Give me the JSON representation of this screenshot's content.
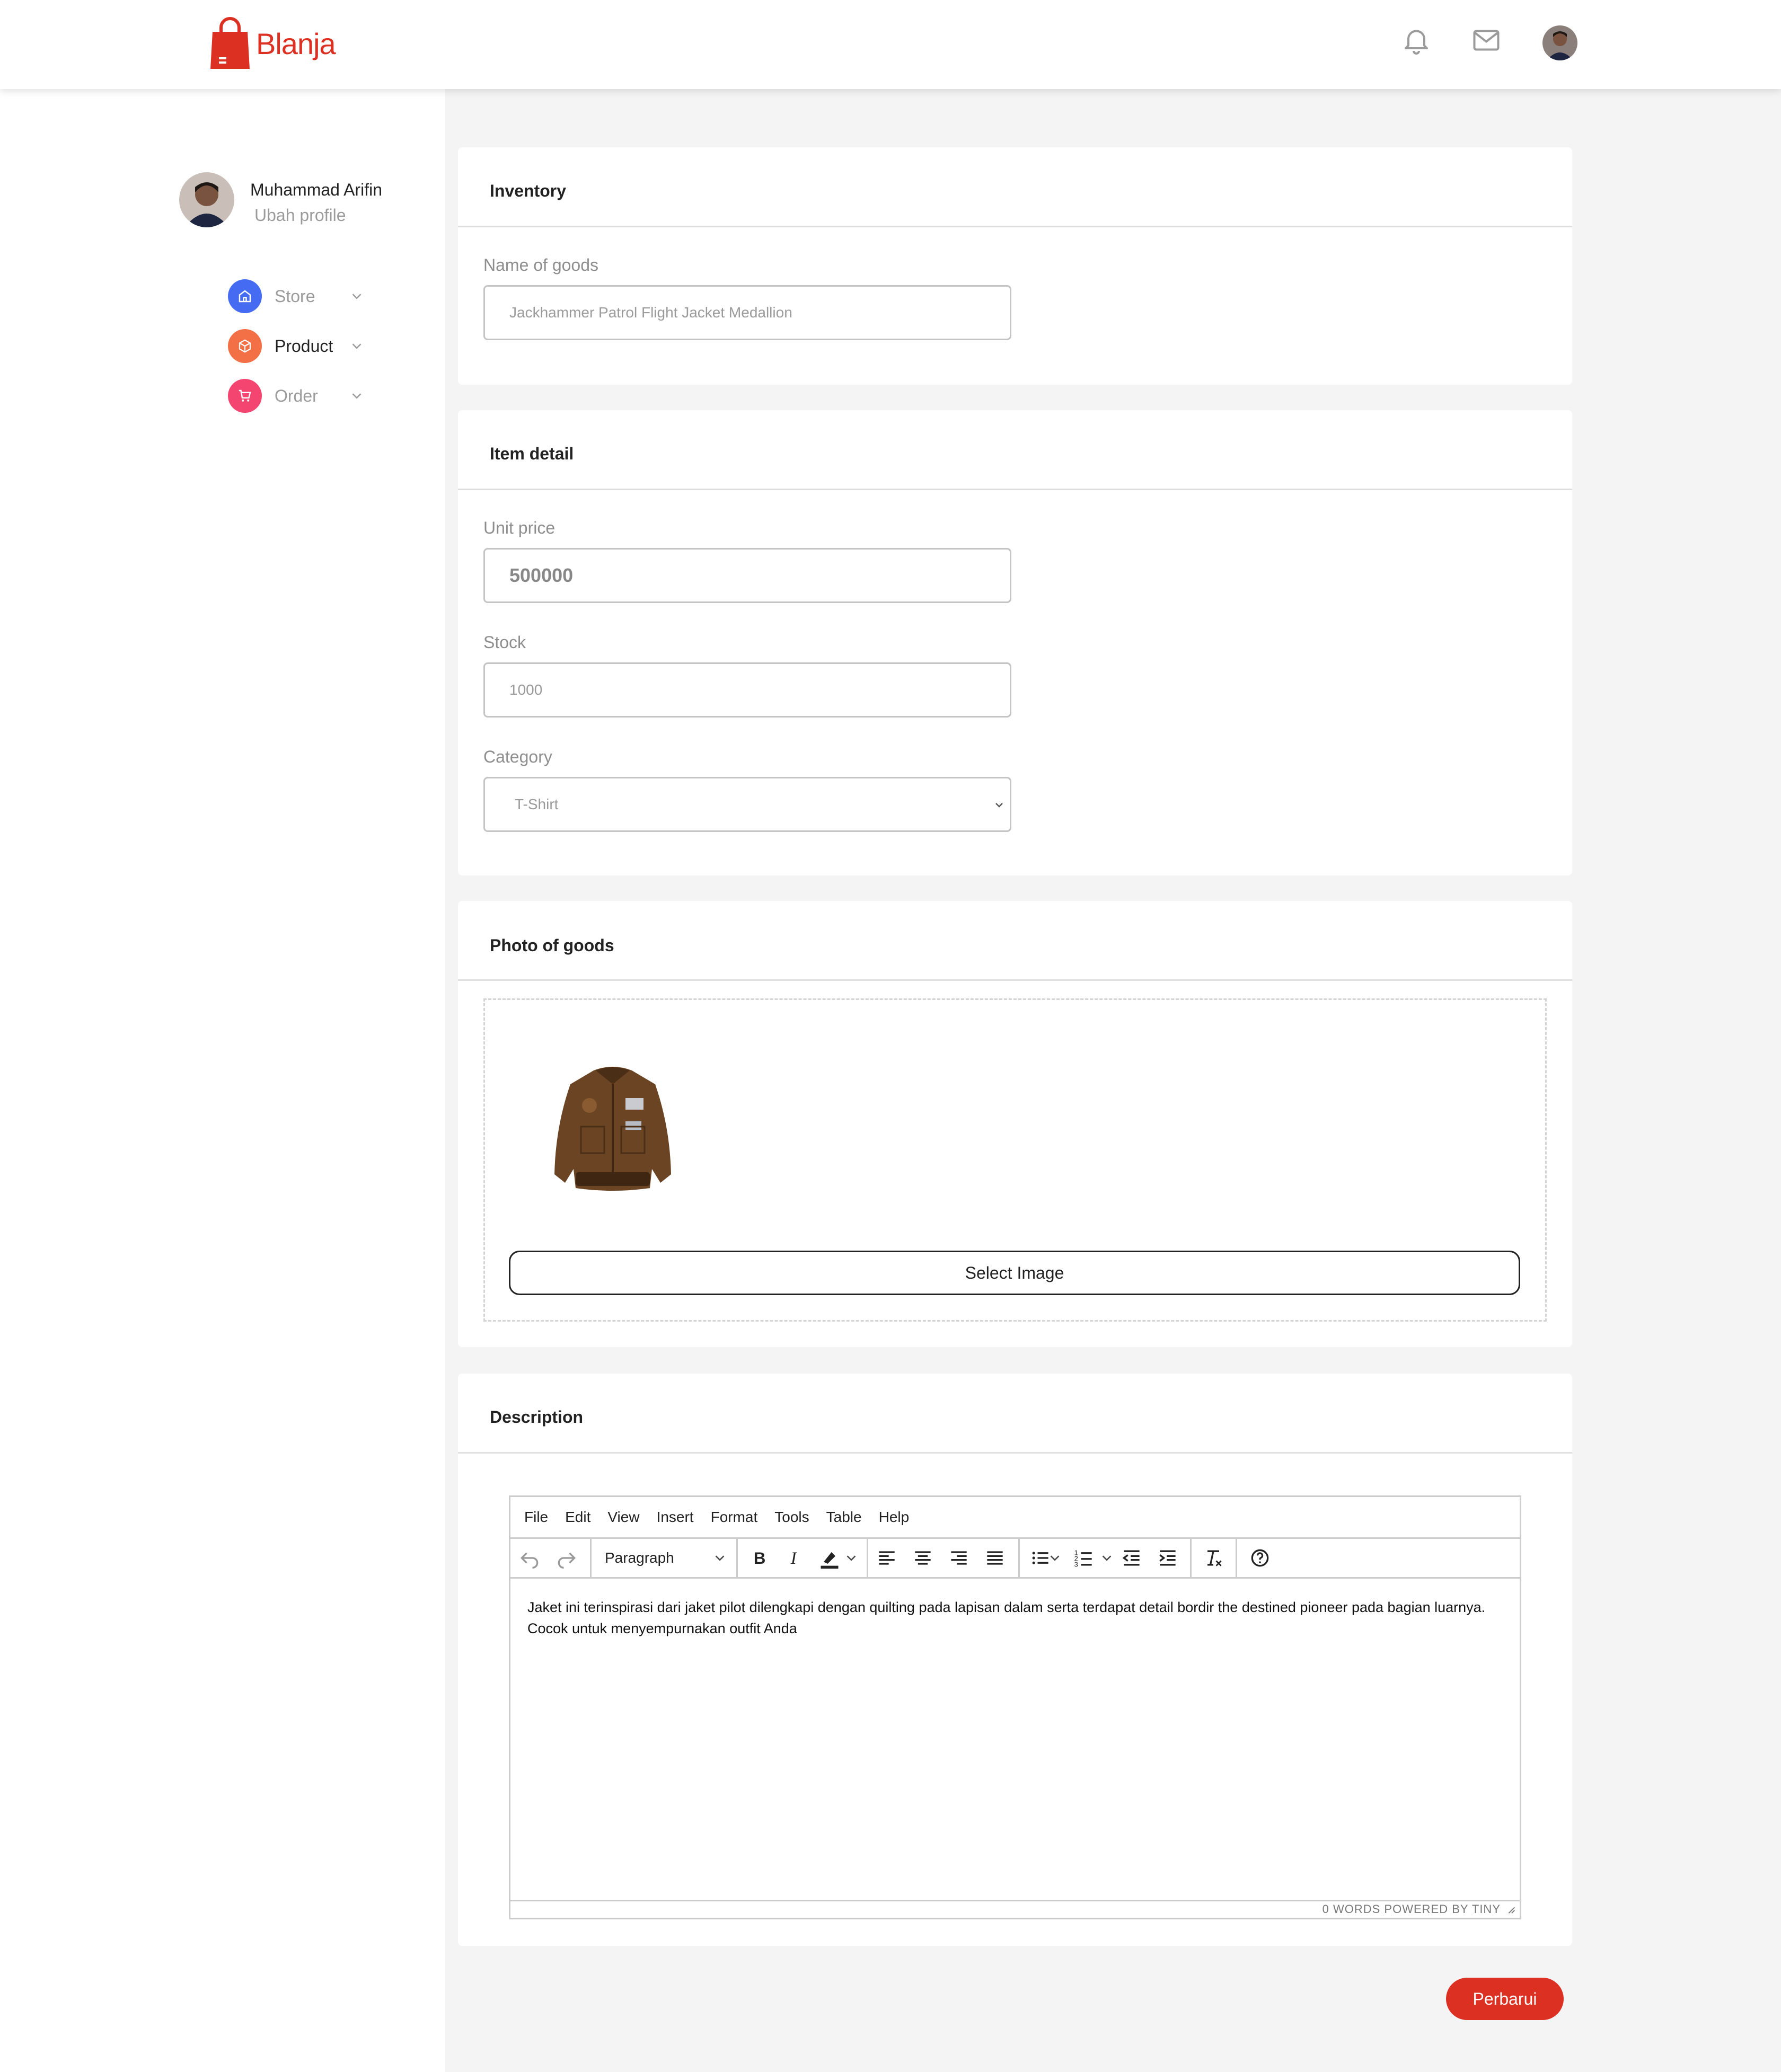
{
  "app": {
    "brand_name": "Blanja",
    "brand_color": "#DB3022"
  },
  "header": {
    "icons": [
      "bell-icon",
      "mail-icon"
    ],
    "avatar": "user-avatar"
  },
  "sidebar": {
    "user_name": "Muhammad Arifin",
    "edit_profile": "Ubah profile",
    "items": [
      {
        "label": "Store",
        "icon": "store-icon",
        "color": "#456BF3"
      },
      {
        "label": "Product",
        "icon": "box-icon",
        "color": "#F36F45"
      },
      {
        "label": "Order",
        "icon": "cart-icon",
        "color": "#F3456F"
      }
    ]
  },
  "inventory": {
    "title": "Inventory",
    "name_label": "Name of goods",
    "name_value": "Jackhammer Patrol Flight Jacket Medallion"
  },
  "item_detail": {
    "title": "Item detail",
    "price_label": "Unit price",
    "price_value": "500000",
    "stock_label": "Stock",
    "stock_value": "1000",
    "category_label": "Category",
    "category_value": "T-Shirt"
  },
  "photo": {
    "title": "Photo of goods",
    "select_button": "Select Image"
  },
  "description": {
    "title": "Description",
    "menu": [
      "File",
      "Edit",
      "View",
      "Insert",
      "Format",
      "Tools",
      "Table",
      "Help"
    ],
    "block_format": "Paragraph",
    "text": "Jaket ini terinspirasi dari jaket pilot dilengkapi dengan quilting pada lapisan dalam serta terdapat detail bordir the destined pioneer pada bagian luarnya. Cocok untuk menyempurnakan outfit Anda",
    "status": "0 WORDS  POWERED BY TINY"
  },
  "submit_button": "Perbarui"
}
